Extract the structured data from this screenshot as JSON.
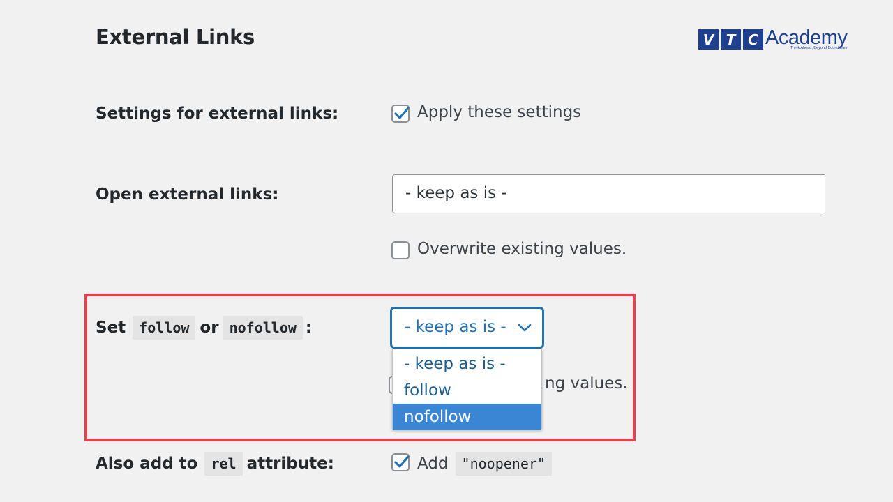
{
  "section": {
    "title": "External Links"
  },
  "logo": {
    "letters": [
      "V",
      "T",
      "C"
    ],
    "name": "Academy",
    "tagline": "Think Ahead, Beyond Boundaries",
    "color": "#1f3f8f"
  },
  "settings_row": {
    "label": "Settings for external links:",
    "checkbox_label": "Apply these settings",
    "checked": true
  },
  "open_row": {
    "label": "Open external links:",
    "value": "- keep as is -",
    "overwrite_label": "Overwrite existing values.",
    "overwrite_checked": false
  },
  "follow_row": {
    "label_prefix": "Set",
    "code_follow": "follow",
    "label_or": "or",
    "code_nofollow": "nofollow",
    "label_suffix": ":",
    "selected_value": "- keep as is -",
    "options": [
      "- keep as is -",
      "follow",
      "nofollow"
    ],
    "highlighted_option": "nofollow",
    "overwrite_label_partial": "ng values."
  },
  "rel_row": {
    "label_prefix": "Also add to",
    "code_rel": "rel",
    "label_suffix": "attribute:",
    "checkbox_label": "Add",
    "code_value": "\"noopener\"",
    "checked": true
  },
  "colors": {
    "accent": "#2271b1",
    "highlight_border": "#e5424d",
    "option_selected": "#3a86d4"
  }
}
